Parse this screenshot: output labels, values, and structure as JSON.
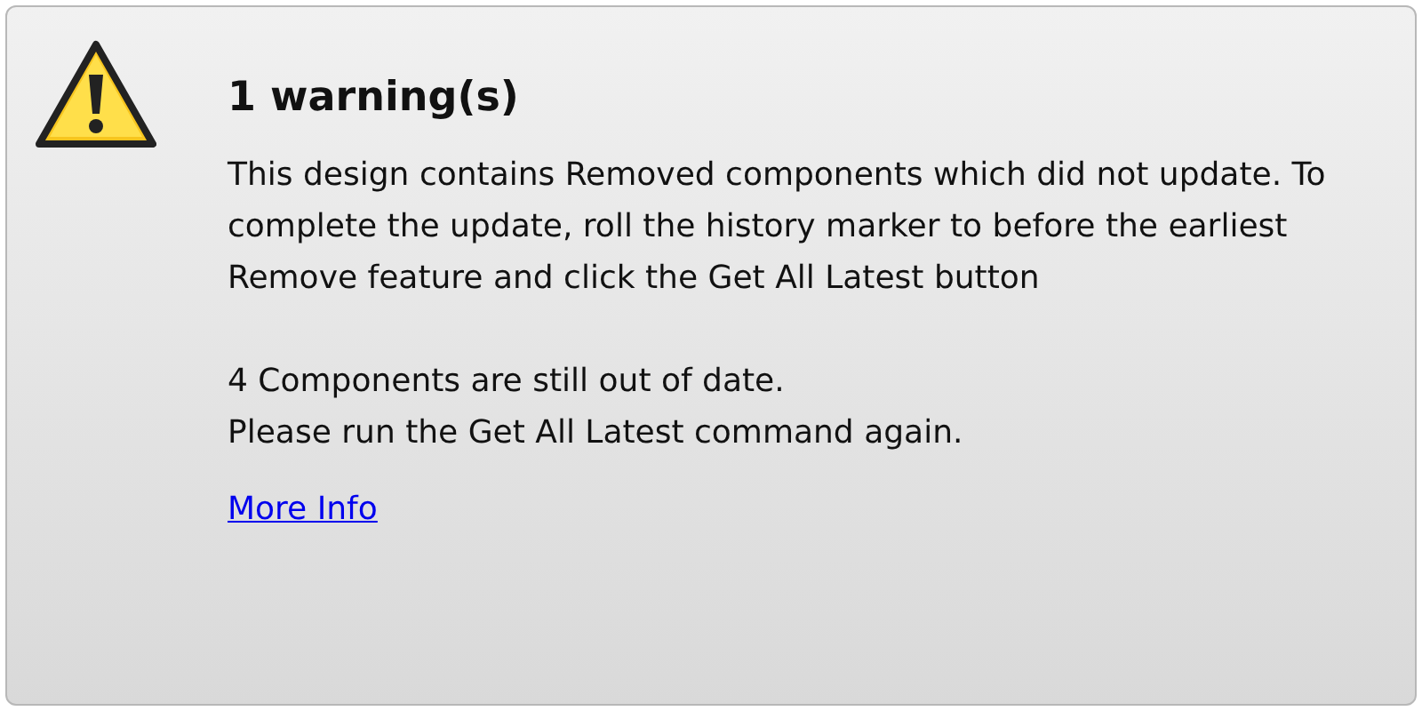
{
  "panel": {
    "title": "1 warning(s)",
    "message": "This design contains Removed components which did not update. To complete the update, roll the history marker to before the earliest Remove feature and click the Get All Latest button",
    "status_lines": [
      "4 Components are still out of date.",
      "Please run the Get All Latest command again."
    ],
    "link": "More Info"
  }
}
